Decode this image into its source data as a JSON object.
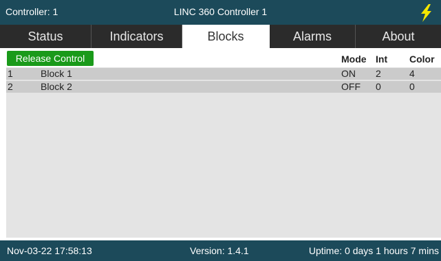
{
  "title": {
    "controller": "Controller: 1",
    "name": "LINC 360 Controller 1"
  },
  "tabs": [
    "Status",
    "Indicators",
    "Blocks",
    "Alarms",
    "About"
  ],
  "active_tab": "Blocks",
  "release_label": "Release Control",
  "columns": {
    "mode": "Mode",
    "int": "Int",
    "color": "Color"
  },
  "blocks": [
    {
      "id": "1",
      "name": "Block 1",
      "mode": "ON",
      "int": "2",
      "color": "4"
    },
    {
      "id": "2",
      "name": "Block 2",
      "mode": "OFF",
      "int": "0",
      "color": "0"
    }
  ],
  "footer": {
    "datetime": "Nov-03-22 17:58:13",
    "version": "Version: 1.4.1",
    "uptime": "Uptime: 0 days 1 hours 7 mins"
  },
  "colors": {
    "header": "#1c4a5a",
    "tabbar": "#2b2b2b",
    "release": "#1a9a1a",
    "bolt": "#f5e600"
  }
}
